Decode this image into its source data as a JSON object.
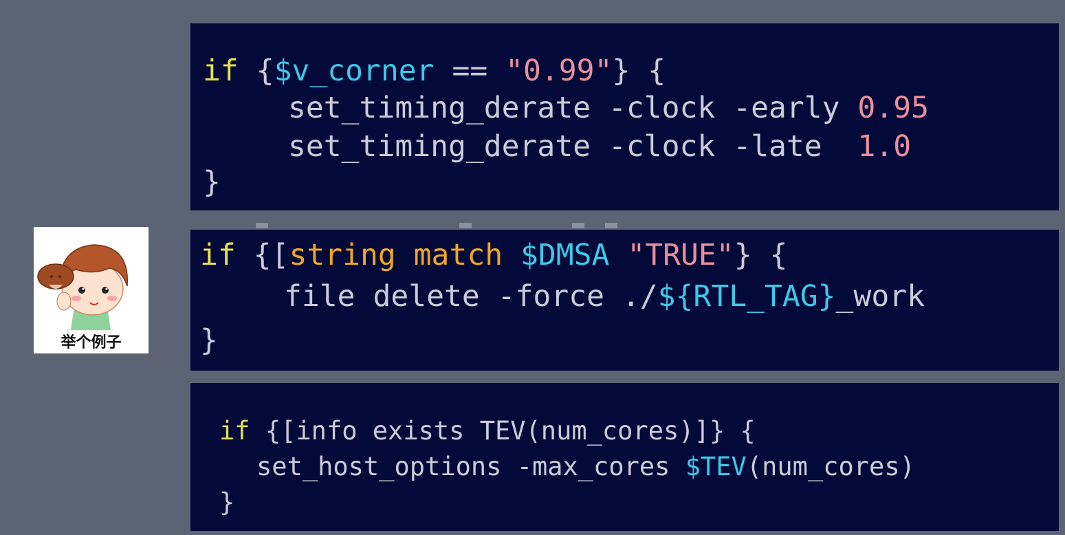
{
  "avatar": {
    "caption": "举个例子",
    "icon": "cartoon-boy-with-mushroom-icon"
  },
  "snippet1": {
    "line1": {
      "kw": "if",
      "p1": " {",
      "var": "$v_corner",
      "p2": " == ",
      "str": "\"0.99\"",
      "p3": "} {"
    },
    "line2": {
      "text": "set_timing_derate -clock -early ",
      "num": "0.95"
    },
    "line3": {
      "text": "set_timing_derate -clock -late  ",
      "num": "1.0"
    },
    "line4": "}"
  },
  "snippet2": {
    "line1": {
      "kw": "if",
      "p1": " {[",
      "cmd": "string match",
      "p2": " ",
      "var": "$DMSA",
      "p3": " ",
      "str": "\"TRUE\"",
      "p4": "} {"
    },
    "line2": {
      "text": "file delete -force ./",
      "var": "${RTL_TAG}",
      "rest": "_work"
    },
    "line3": "}"
  },
  "snippet3": {
    "line1": {
      "kw": "if",
      "rest": " {[info exists TEV(num_cores)]} {"
    },
    "line2": {
      "text": "set_host_options -max_cores ",
      "var": "$TEV",
      "rest": "(num_cores)"
    },
    "line3": "}"
  },
  "colors": {
    "background": "#5c6373",
    "panel": "#030a3a",
    "keyword": "#e8df4e",
    "variable": "#3ec8e8",
    "string": "#ea8f9a",
    "command": "#f0a620",
    "text": "#c9ccd6"
  }
}
